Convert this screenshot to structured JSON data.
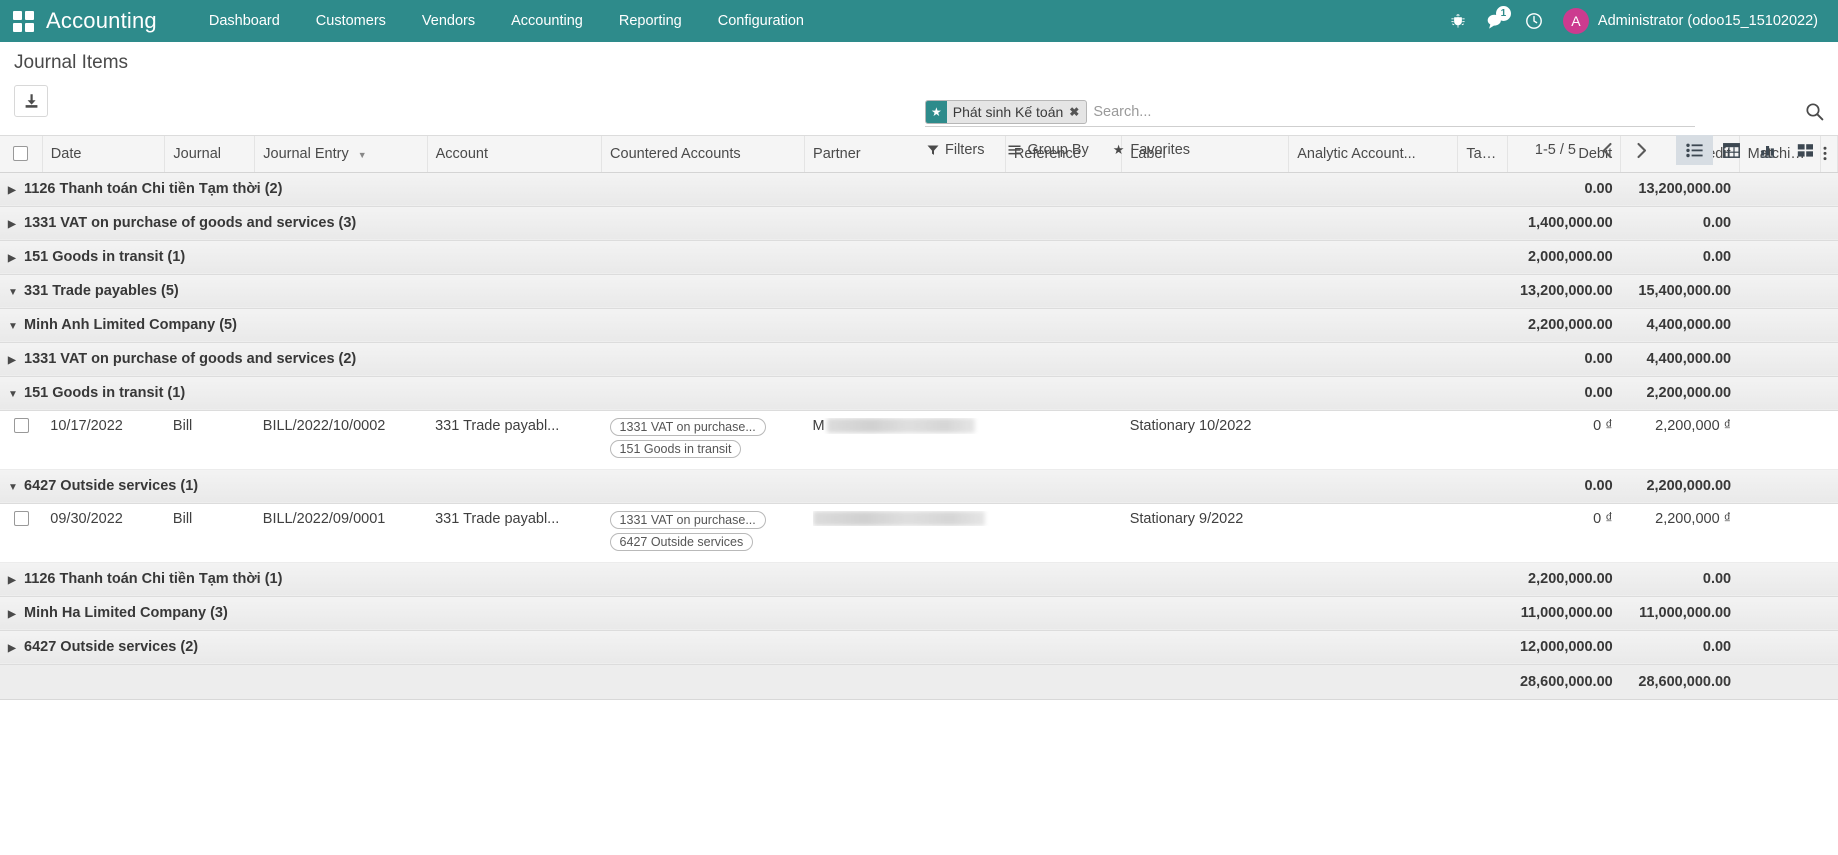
{
  "navbar": {
    "apps_icon": "apps-grid-icon",
    "brand": "Accounting",
    "menu": [
      {
        "label": "Dashboard"
      },
      {
        "label": "Customers"
      },
      {
        "label": "Vendors"
      },
      {
        "label": "Accounting"
      },
      {
        "label": "Reporting"
      },
      {
        "label": "Configuration"
      }
    ],
    "right": {
      "debug_icon": "bug-icon",
      "messaging_icon": "chat-bubble-icon",
      "messaging_count": "1",
      "activity_icon": "clock-icon",
      "avatar_initial": "A",
      "user_name": "Administrator (odoo15_15102022)"
    }
  },
  "control_panel": {
    "title": "Journal Items",
    "download_icon": "download-icon",
    "search": {
      "facet_icon": "star-icon",
      "facet_label": "Phát sinh Kế toán",
      "facet_close_icon": "close-icon",
      "placeholder": "Search...",
      "value": "",
      "magnifier_icon": "search-icon"
    },
    "buttons": {
      "filters": "Filters",
      "filters_icon": "filter-icon",
      "group_by": "Group By",
      "group_by_icon": "bars-icon",
      "favorites": "Favorites",
      "favorites_icon": "star-icon"
    },
    "pager": {
      "count": "1-5 / 5",
      "previous_icon": "chevron-left-icon",
      "next_icon": "chevron-right-icon"
    },
    "views": [
      {
        "name": "list-view",
        "icon": "list-icon",
        "active": true
      },
      {
        "name": "pivot-view",
        "icon": "table-icon",
        "active": false
      },
      {
        "name": "graph-view",
        "icon": "bar-chart-icon",
        "active": false
      },
      {
        "name": "kanban-view",
        "icon": "kanban-icon",
        "active": false
      }
    ]
  },
  "table": {
    "columns": [
      {
        "key": "date",
        "label": "Date"
      },
      {
        "key": "journal",
        "label": "Journal"
      },
      {
        "key": "journal_entry",
        "label": "Journal Entry",
        "sorted": true,
        "sort_icon": "caret-down-icon"
      },
      {
        "key": "account",
        "label": "Account"
      },
      {
        "key": "countered_accounts",
        "label": "Countered Accounts"
      },
      {
        "key": "partner",
        "label": "Partner"
      },
      {
        "key": "reference",
        "label": "Reference"
      },
      {
        "key": "label",
        "label": "Label"
      },
      {
        "key": "analytic_account",
        "label": "Analytic Account..."
      },
      {
        "key": "taxes",
        "label": "Taxes"
      },
      {
        "key": "debit",
        "label": "Debit"
      },
      {
        "key": "credit",
        "label": "Credit"
      },
      {
        "key": "matching",
        "label": "Matching #"
      }
    ],
    "optional_columns_icon": "dots-vertical-icon",
    "rows": [
      {
        "type": "group",
        "level": 0,
        "expanded": false,
        "label": "1126 Thanh toán Chi tiền Tạm thời (2)",
        "debit": "0.00",
        "credit": "13,200,000.00"
      },
      {
        "type": "group",
        "level": 0,
        "expanded": false,
        "label": "1331 VAT on purchase of goods and services (3)",
        "debit": "1,400,000.00",
        "credit": "0.00"
      },
      {
        "type": "group",
        "level": 0,
        "expanded": false,
        "label": "151 Goods in transit (1)",
        "debit": "2,000,000.00",
        "credit": "0.00"
      },
      {
        "type": "group",
        "level": 0,
        "expanded": true,
        "label": "331 Trade payables (5)",
        "debit": "13,200,000.00",
        "credit": "15,400,000.00"
      },
      {
        "type": "group",
        "level": 1,
        "expanded": true,
        "label": "Minh Anh Limited Company (5)",
        "debit": "2,200,000.00",
        "credit": "4,400,000.00"
      },
      {
        "type": "group",
        "level": 2,
        "expanded": false,
        "label": "1331 VAT on purchase of goods and services (2)",
        "debit": "0.00",
        "credit": "4,400,000.00"
      },
      {
        "type": "group",
        "level": 2,
        "expanded": true,
        "label": "151 Goods in transit (1)",
        "debit": "0.00",
        "credit": "2,200,000.00"
      },
      {
        "type": "record",
        "date": "10/17/2022",
        "journal": "Bill",
        "journal_entry": "BILL/2022/10/0002",
        "account": "331 Trade payabl...",
        "countered_accounts": [
          "1331 VAT on purchase...",
          "151 Goods in transit"
        ],
        "partner_prefix": "M",
        "partner_redacted": true,
        "reference": "",
        "label": "Stationary 10/2022",
        "analytic_account": "",
        "taxes": "",
        "debit": "0 ₫",
        "credit": "2,200,000 ₫",
        "matching": ""
      },
      {
        "type": "group",
        "level": 2,
        "expanded": true,
        "label": "6427 Outside services (1)",
        "debit": "0.00",
        "credit": "2,200,000.00"
      },
      {
        "type": "record",
        "date": "09/30/2022",
        "journal": "Bill",
        "journal_entry": "BILL/2022/09/0001",
        "account": "331 Trade payabl...",
        "countered_accounts": [
          "1331 VAT on purchase...",
          "6427 Outside services"
        ],
        "partner_prefix": "",
        "partner_redacted": true,
        "reference": "",
        "label": "Stationary 9/2022",
        "analytic_account": "",
        "taxes": "",
        "debit": "0 ₫",
        "credit": "2,200,000 ₫",
        "matching": ""
      },
      {
        "type": "group",
        "level": 2,
        "expanded": false,
        "label": "1126 Thanh toán Chi tiền Tạm thời (1)",
        "debit": "2,200,000.00",
        "credit": "0.00"
      },
      {
        "type": "group",
        "level": 1,
        "expanded": false,
        "label": "Minh Ha Limited Company (3)",
        "debit": "11,000,000.00",
        "credit": "11,000,000.00"
      },
      {
        "type": "group",
        "level": 0,
        "expanded": false,
        "label": "6427 Outside services (2)",
        "debit": "12,000,000.00",
        "credit": "0.00"
      }
    ],
    "totals": {
      "debit": "28,600,000.00",
      "credit": "28,600,000.00"
    }
  },
  "colors": {
    "brand": "#2e8b8b",
    "avatar": "#cc3b8f",
    "active_view": "#d7dde3"
  }
}
